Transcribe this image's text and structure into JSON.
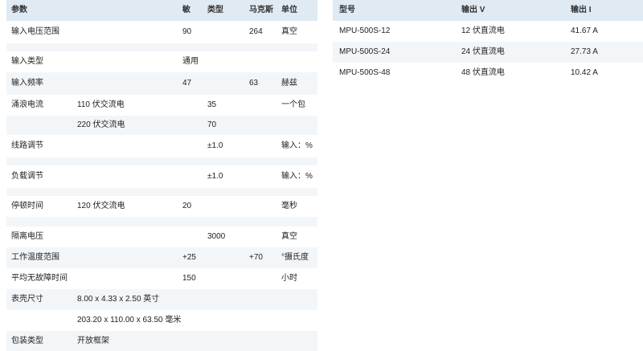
{
  "specs": {
    "headers": {
      "param": "参数",
      "min": "敏",
      "type": "类型",
      "max": "马克斯",
      "unit": "单位"
    },
    "rows": [
      {
        "param": "输入电压范围",
        "sub": "",
        "min": "90",
        "type": "",
        "max": "264",
        "unit": "真空"
      },
      {
        "param": "",
        "sub": "",
        "min": "",
        "type": "",
        "max": "",
        "unit": ""
      },
      {
        "param": "输入类型",
        "sub": "",
        "min": "通用",
        "type": "",
        "max": "",
        "unit": ""
      },
      {
        "param": "输入频率",
        "sub": "",
        "min": "47",
        "type": "",
        "max": "63",
        "unit": "赫兹"
      },
      {
        "param": "涌浪电流",
        "sub": "110 伏交流电",
        "min": "",
        "type": "35",
        "max": "",
        "unit": "一个包"
      },
      {
        "param": "",
        "sub": "220 伏交流电",
        "min": "",
        "type": "70",
        "max": "",
        "unit": ""
      },
      {
        "param": "线路调节",
        "sub": "",
        "min": "",
        "type": "±1.0",
        "max": "",
        "unit": "输入：%"
      },
      {
        "param": "",
        "sub": "",
        "min": "",
        "type": "",
        "max": "",
        "unit": ""
      },
      {
        "param": "负载调节",
        "sub": "",
        "min": "",
        "type": "±1.0",
        "max": "",
        "unit": "输入：%"
      },
      {
        "param": "",
        "sub": "",
        "min": "",
        "type": "",
        "max": "",
        "unit": ""
      },
      {
        "param": "停顿时间",
        "sub": "120 伏交流电",
        "min": "20",
        "type": "",
        "max": "",
        "unit": "毫秒"
      },
      {
        "param": "",
        "sub": "",
        "min": "",
        "type": "",
        "max": "",
        "unit": ""
      },
      {
        "param": "隔离电压",
        "sub": "",
        "min": "",
        "type": "3000",
        "max": "",
        "unit": "真空"
      },
      {
        "param": "工作温度范围",
        "sub": "",
        "min": "+25",
        "type": "",
        "max": "+70",
        "unit": "°摄氏度"
      },
      {
        "param": "平均无故障时间",
        "sub": "",
        "min": "150",
        "type": "",
        "max": "",
        "unit": "小时"
      },
      {
        "param": "表壳尺寸",
        "sub": "8.00 x 4.33 x 2.50 英寸",
        "min": "",
        "type": "",
        "max": "",
        "unit": ""
      },
      {
        "param": "",
        "sub": "203.20 x 110.00 x 63.50 毫米",
        "min": "",
        "type": "",
        "max": "",
        "unit": ""
      },
      {
        "param": "包装类型",
        "sub": "开放框架",
        "min": "",
        "type": "",
        "max": "",
        "unit": ""
      }
    ]
  },
  "models": {
    "headers": {
      "model": "型号",
      "vout": "输出 V",
      "iout": "输出 I"
    },
    "rows": [
      {
        "model": "MPU-500S-12",
        "vout": "12 伏直流电",
        "iout": "41.67 A"
      },
      {
        "model": "MPU-500S-24",
        "vout": "24 伏直流电",
        "iout": "27.73 A"
      },
      {
        "model": "MPU-500S-48",
        "vout": "48 伏直流电",
        "iout": "10.42 A"
      }
    ]
  }
}
